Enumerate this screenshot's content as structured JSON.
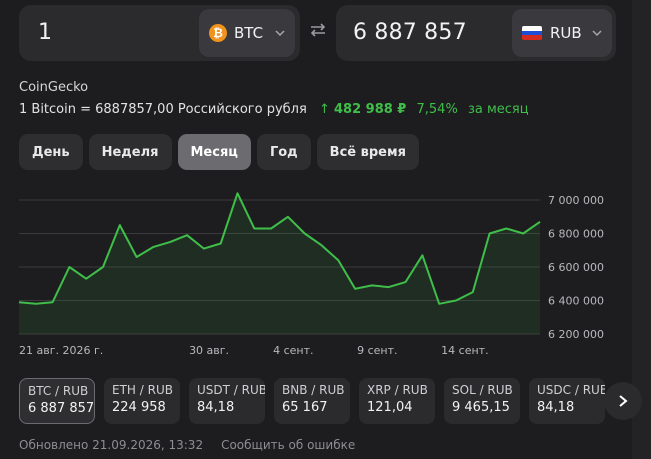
{
  "converter": {
    "from": {
      "amount": "1",
      "currency": "BTC",
      "icon": "bitcoin-icon",
      "icon_glyph": "₿"
    },
    "to": {
      "amount": "6 887 857",
      "currency": "RUB",
      "icon": "russia-flag-icon"
    },
    "swap_icon": "swap-arrows-icon"
  },
  "source": "CoinGecko",
  "rate": {
    "text": "1 Bitcoin = 6887857,00 Российского рубля",
    "change_arrow": "↑",
    "change_amount": "482 988 ₽",
    "change_percent": "7,54%",
    "period": "за месяц",
    "positive_color": "#3fbf4a"
  },
  "tabs": [
    {
      "label": "День",
      "active": false
    },
    {
      "label": "Неделя",
      "active": false
    },
    {
      "label": "Месяц",
      "active": true
    },
    {
      "label": "Год",
      "active": false
    },
    {
      "label": "Всё время",
      "active": false
    }
  ],
  "chart_data": {
    "type": "area",
    "y_ticks": [
      "7 000 000",
      "6 800 000",
      "6 600 000",
      "6 400 000",
      "6 200 000"
    ],
    "x_ticks": [
      "21 авг. 2026 г.",
      "30 авг.",
      "4 сент.",
      "9 сент.",
      "14 сент."
    ],
    "ylim": [
      6200000,
      7000000
    ],
    "grid": true,
    "line_color": "#3fbf4a",
    "values": [
      6390000,
      6380000,
      6390000,
      6600000,
      6530000,
      6600000,
      6850000,
      6660000,
      6720000,
      6750000,
      6790000,
      6710000,
      6740000,
      7040000,
      6830000,
      6830000,
      6900000,
      6800000,
      6730000,
      6640000,
      6470000,
      6490000,
      6480000,
      6510000,
      6670000,
      6380000,
      6400000,
      6450000,
      6800000,
      6830000,
      6800000,
      6870000
    ]
  },
  "pairs": [
    {
      "symbol": "BTC / RUB",
      "value": "6 887 857",
      "active": true
    },
    {
      "symbol": "ETH / RUB",
      "value": "224 958",
      "active": false
    },
    {
      "symbol": "USDT / RUB",
      "value": "84,18",
      "active": false
    },
    {
      "symbol": "BNB / RUB",
      "value": "65 167",
      "active": false
    },
    {
      "symbol": "XRP / RUB",
      "value": "121,04",
      "active": false
    },
    {
      "symbol": "SOL / RUB",
      "value": "9 465,15",
      "active": false
    },
    {
      "symbol": "USDC / RUB",
      "value": "84,18",
      "active": false
    }
  ],
  "footer": {
    "updated": "Обновлено 21.09.2026, 13:32",
    "report": "Сообщить об ошибке"
  }
}
